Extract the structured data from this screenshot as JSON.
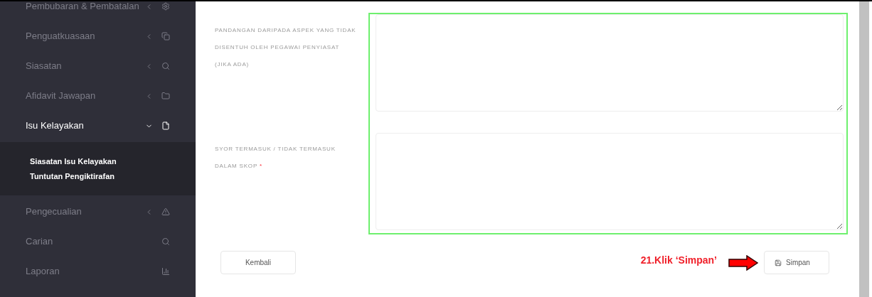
{
  "sidebar": {
    "items": [
      {
        "label": "Pembubaran & Pembatalan",
        "kind": "collapsed",
        "expanded": false
      },
      {
        "label": "Penguatkuasaan",
        "kind": "collapsed",
        "expanded": false
      },
      {
        "label": "Siasatan",
        "kind": "collapsed",
        "expanded": false
      },
      {
        "label": "Afidavit Jawapan",
        "kind": "collapsed",
        "expanded": false
      },
      {
        "label": "Isu Kelayakan",
        "kind": "collapsed",
        "expanded": true,
        "children": [
          {
            "label": "Siasatan Isu Kelayakan"
          },
          {
            "label": "Tuntutan Pengiktirafan"
          }
        ]
      },
      {
        "label": "Pengecualian",
        "kind": "collapsed",
        "expanded": false
      },
      {
        "label": "Carian",
        "kind": "plain"
      },
      {
        "label": "Laporan",
        "kind": "plain"
      }
    ]
  },
  "form": {
    "fields": [
      {
        "label": "PANDANGAN DARIPADA ASPEK YANG TIDAK DISENTUH OLEH PEGAWAI PENYIASAT (JIKA ADA)"
      },
      {
        "label": "SYOR TERMASUK / TIDAK TERMASUK DALAM SKOP",
        "required_mark": "*"
      }
    ],
    "back_button": "Kembali",
    "save_button": "Simpan"
  },
  "annotation": {
    "text": "21.Klik ‘Simpan’"
  }
}
